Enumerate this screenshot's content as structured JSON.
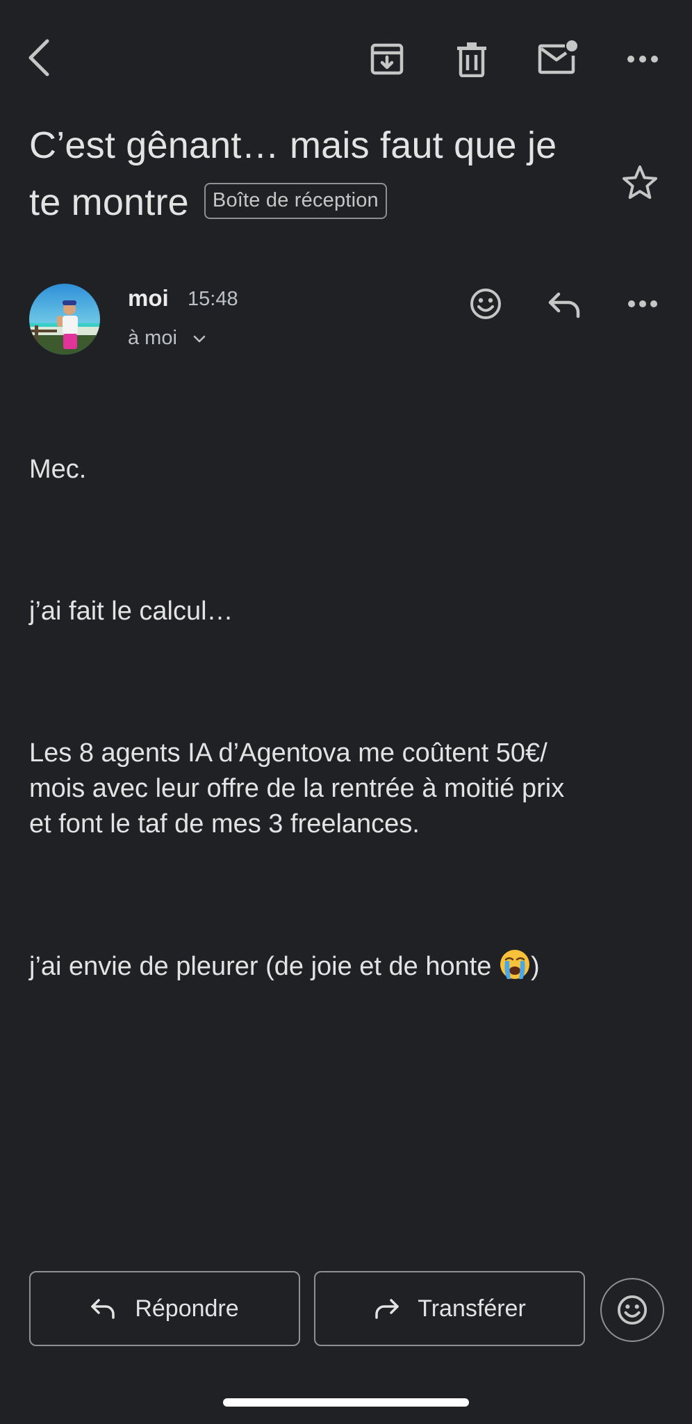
{
  "toolbar": {
    "back_icon": "chevron-left-icon",
    "archive_icon": "archive-icon",
    "delete_icon": "trash-icon",
    "mark_unread_icon": "mail-unread-icon",
    "more_icon": "more-horizontal-icon"
  },
  "email": {
    "subject": "C’est gênant… mais faut que je te montre",
    "label": "Boîte de réception",
    "starred": false,
    "sender": {
      "name": "moi",
      "time": "15:48",
      "recipient": "à moi"
    },
    "body": [
      "Mec.",
      "j’ai fait le calcul…",
      "Les 8 agents IA d’Agentova me coûtent 50€/\nmois avec leur offre de la rentrée à moitié prix\net font le taf de mes 3 freelances.",
      "j’ai envie de pleurer (de joie et de honte "
    ],
    "body_last_suffix": ")"
  },
  "actions": {
    "reply_label": "Répondre",
    "forward_label": "Transférer"
  },
  "colors": {
    "background": "#202124",
    "text": "#e3e3e3",
    "muted": "#bdc1c6",
    "outline": "#8e918f"
  }
}
